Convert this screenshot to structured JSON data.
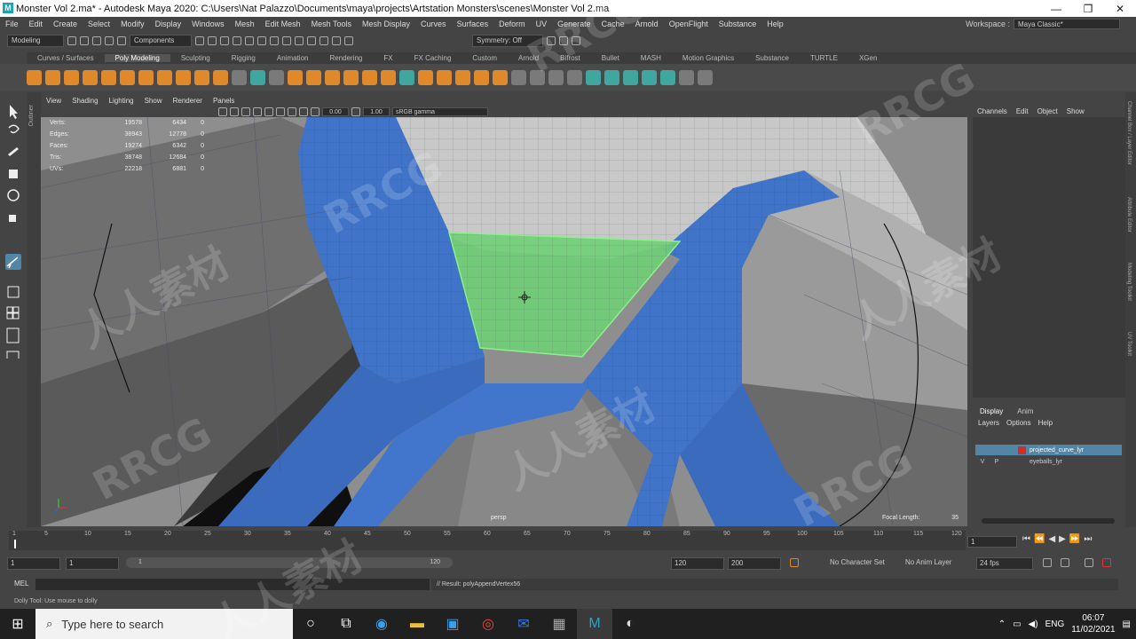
{
  "window": {
    "title": "Monster Vol 2.ma* - Autodesk Maya 2020: C:\\Users\\Nat Palazzo\\Documents\\maya\\projects\\Artstation Monsters\\scenes\\Monster Vol 2.ma",
    "app_icon": "M",
    "minimize": "—",
    "maximize": "❐",
    "close": "✕"
  },
  "menubar": {
    "items": [
      "File",
      "Edit",
      "Create",
      "Select",
      "Modify",
      "Display",
      "Windows",
      "Mesh",
      "Edit Mesh",
      "Mesh Tools",
      "Mesh Display",
      "Curves",
      "Surfaces",
      "Deform",
      "UV",
      "Generate",
      "Cache",
      "Arnold",
      "OpenFlight",
      "Substance",
      "Help"
    ],
    "workspace_label": "Workspace :",
    "workspace_value": "Maya Classic*"
  },
  "statusline": {
    "mode": "Modeling",
    "components": "Components",
    "symmetry": "Symmetry: Off"
  },
  "shelf": {
    "tabs": [
      "Curves / Surfaces",
      "Poly Modeling",
      "Sculpting",
      "Rigging",
      "Animation",
      "Rendering",
      "FX",
      "FX Caching",
      "Custom",
      "Arnold",
      "Bifrost",
      "Bullet",
      "MASH",
      "Motion Graphics",
      "Substance",
      "TURTLE",
      "XGen"
    ],
    "active_tab": "Poly Modeling"
  },
  "viewport": {
    "menu": [
      "View",
      "Shading",
      "Lighting",
      "Show",
      "Renderer",
      "Panels"
    ],
    "exposure": "0.00",
    "gamma": "1.00",
    "color_space": "sRGB gamma",
    "camera": "persp",
    "focal_label": "Focal Length:",
    "focal_value": "35",
    "hud": [
      {
        "k": "Verts:",
        "a": "19578",
        "b": "6434",
        "c": "0"
      },
      {
        "k": "Edges:",
        "a": "38943",
        "b": "12778",
        "c": "0"
      },
      {
        "k": "Faces:",
        "a": "19274",
        "b": "6342",
        "c": "0"
      },
      {
        "k": "Tris:",
        "a": "38748",
        "b": "12684",
        "c": "0"
      },
      {
        "k": "UVs:",
        "a": "22218",
        "b": "6881",
        "c": "0"
      }
    ]
  },
  "side_labels": {
    "outliner": "Outliner",
    "channel_box": "Channel Box / Layer Editor",
    "attribute_editor": "Attribute Editor",
    "modeling_toolkit": "Modeling Toolkit",
    "uv_toolkit": "UV Toolkit"
  },
  "channel_box": {
    "menu": [
      "Channels",
      "Edit",
      "Object",
      "Show"
    ]
  },
  "layer_editor": {
    "tabs": [
      "Display",
      "Anim"
    ],
    "menu": [
      "Layers",
      "Options",
      "Help"
    ],
    "layers": [
      {
        "vis": "",
        "p": "",
        "name": "projected_curve_lyr",
        "color": "#d42a2a"
      },
      {
        "vis": "V",
        "p": "P",
        "name": "eyeballs_lyr",
        "color": ""
      }
    ]
  },
  "timeslider": {
    "ticks": [
      "1",
      "5",
      "10",
      "15",
      "20",
      "25",
      "30",
      "35",
      "40",
      "45",
      "50",
      "55",
      "60",
      "65",
      "70",
      "75",
      "80",
      "85",
      "90",
      "95",
      "100",
      "105",
      "110",
      "115",
      "120"
    ],
    "current_frame": "1"
  },
  "range": {
    "start": "1",
    "start_inner": "1",
    "slider_lo": "1",
    "slider_hi": "120",
    "end_inner": "120",
    "end": "200",
    "character_set": "No Character Set",
    "anim_layer": "No Anim Layer",
    "fps": "24 fps"
  },
  "command_line": {
    "mel": "MEL",
    "result": "// Result: polyAppendVertex56"
  },
  "help_line": "Dolly Tool: Use mouse to dolly",
  "taskbar": {
    "search_placeholder": "Type here to search",
    "language": "ENG",
    "time": "06:07",
    "date": "11/02/2021"
  },
  "watermarks": [
    "RRCG",
    "人人素材",
    "RRCG",
    "人人素材",
    "RRCG",
    "人人素材",
    "RRCG",
    "人人素材",
    "RRCG"
  ]
}
